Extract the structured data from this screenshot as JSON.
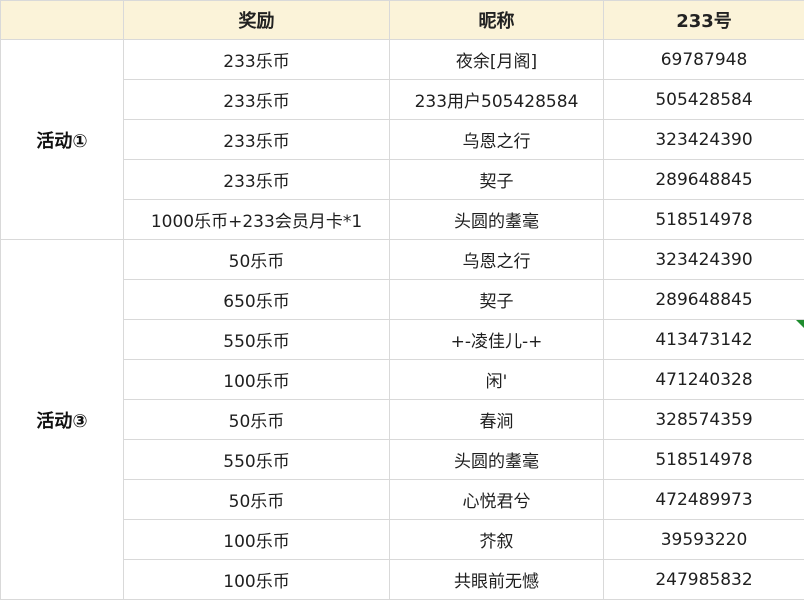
{
  "headers": {
    "reward": "奖励",
    "nickname": "昵称",
    "id": "233号"
  },
  "groups": [
    {
      "event": "活动①",
      "rows": [
        {
          "reward": "233乐币",
          "nickname": "夜余[月阁]",
          "id": "69787948"
        },
        {
          "reward": "233乐币",
          "nickname": "233用户505428584",
          "id": "505428584"
        },
        {
          "reward": "233乐币",
          "nickname": "乌恩之行",
          "id": "323424390"
        },
        {
          "reward": "233乐币",
          "nickname": "契子",
          "id": "289648845"
        },
        {
          "reward": "1000乐币+233会员月卡*1",
          "nickname": "头圆的耋毫",
          "id": "518514978"
        }
      ]
    },
    {
      "event": "活动③",
      "rows": [
        {
          "reward": "50乐币",
          "nickname": "乌恩之行",
          "id": "323424390"
        },
        {
          "reward": "650乐币",
          "nickname": "契子",
          "id": "289648845"
        },
        {
          "reward": "550乐币",
          "nickname": "+-凌佳儿-+",
          "id": "413473142"
        },
        {
          "reward": "100乐币",
          "nickname": "闲'",
          "id": "471240328"
        },
        {
          "reward": "50乐币",
          "nickname": "春涧",
          "id": "328574359"
        },
        {
          "reward": "550乐币",
          "nickname": "头圆的耋毫",
          "id": "518514978"
        },
        {
          "reward": "50乐币",
          "nickname": "心悦君兮",
          "id": "472489973"
        },
        {
          "reward": "100乐币",
          "nickname": "芥叙",
          "id": "39593220"
        },
        {
          "reward": "100乐币",
          "nickname": "共眼前无憾",
          "id": "247985832"
        }
      ]
    }
  ],
  "colors": {
    "header_bg": "#fbf3d9",
    "border": "#d9d9d9",
    "cell_marker": "#1e8c2e"
  }
}
